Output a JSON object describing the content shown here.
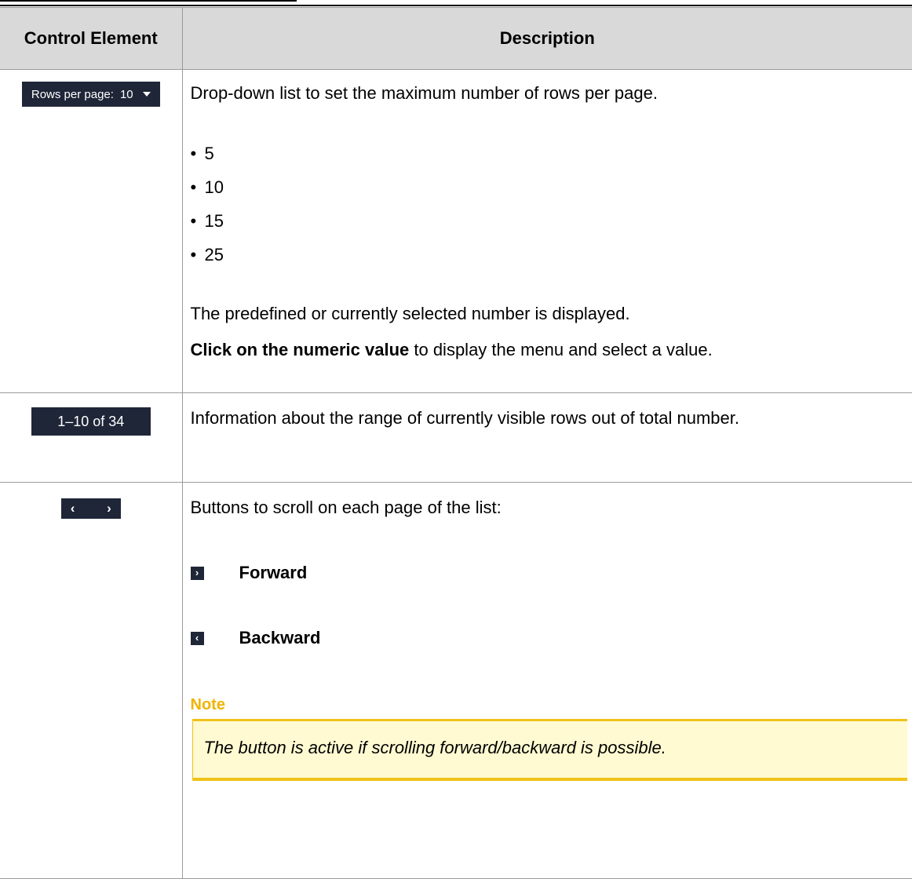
{
  "table": {
    "header": {
      "col1": "Control Element",
      "col2": "Description"
    },
    "row_rows_per_page": {
      "widget_label": "Rows per page:",
      "widget_value": "10",
      "intro": "Drop-down list to set the maximum number of rows per page.",
      "options": [
        "5",
        "10",
        "15",
        "25"
      ],
      "info": "The predefined or currently selected number is displayed.",
      "instruction_bold": "Click on the numeric value",
      "instruction_rest": " to display the menu and select a value."
    },
    "row_range": {
      "widget_text": "1–10 of 34",
      "description": "Information about the range of currently visible rows out of total number."
    },
    "row_nav": {
      "prev_glyph": "‹",
      "next_glyph": "›",
      "intro": "Buttons to scroll on each page of the list:",
      "forward_label": "Forward",
      "backward_label": "Backward",
      "note_title": "Note",
      "note_text": "The button is active if scrolling forward/backward is possible."
    }
  },
  "colors": {
    "widget_bg": "#1f2638",
    "note_title": "#f0b400",
    "note_border": "#f0c21a",
    "note_bg": "#fffad1",
    "header_bg": "#d9d9d9"
  },
  "icons": [
    "caret-down-icon",
    "chevron-left-icon",
    "chevron-right-icon"
  ]
}
